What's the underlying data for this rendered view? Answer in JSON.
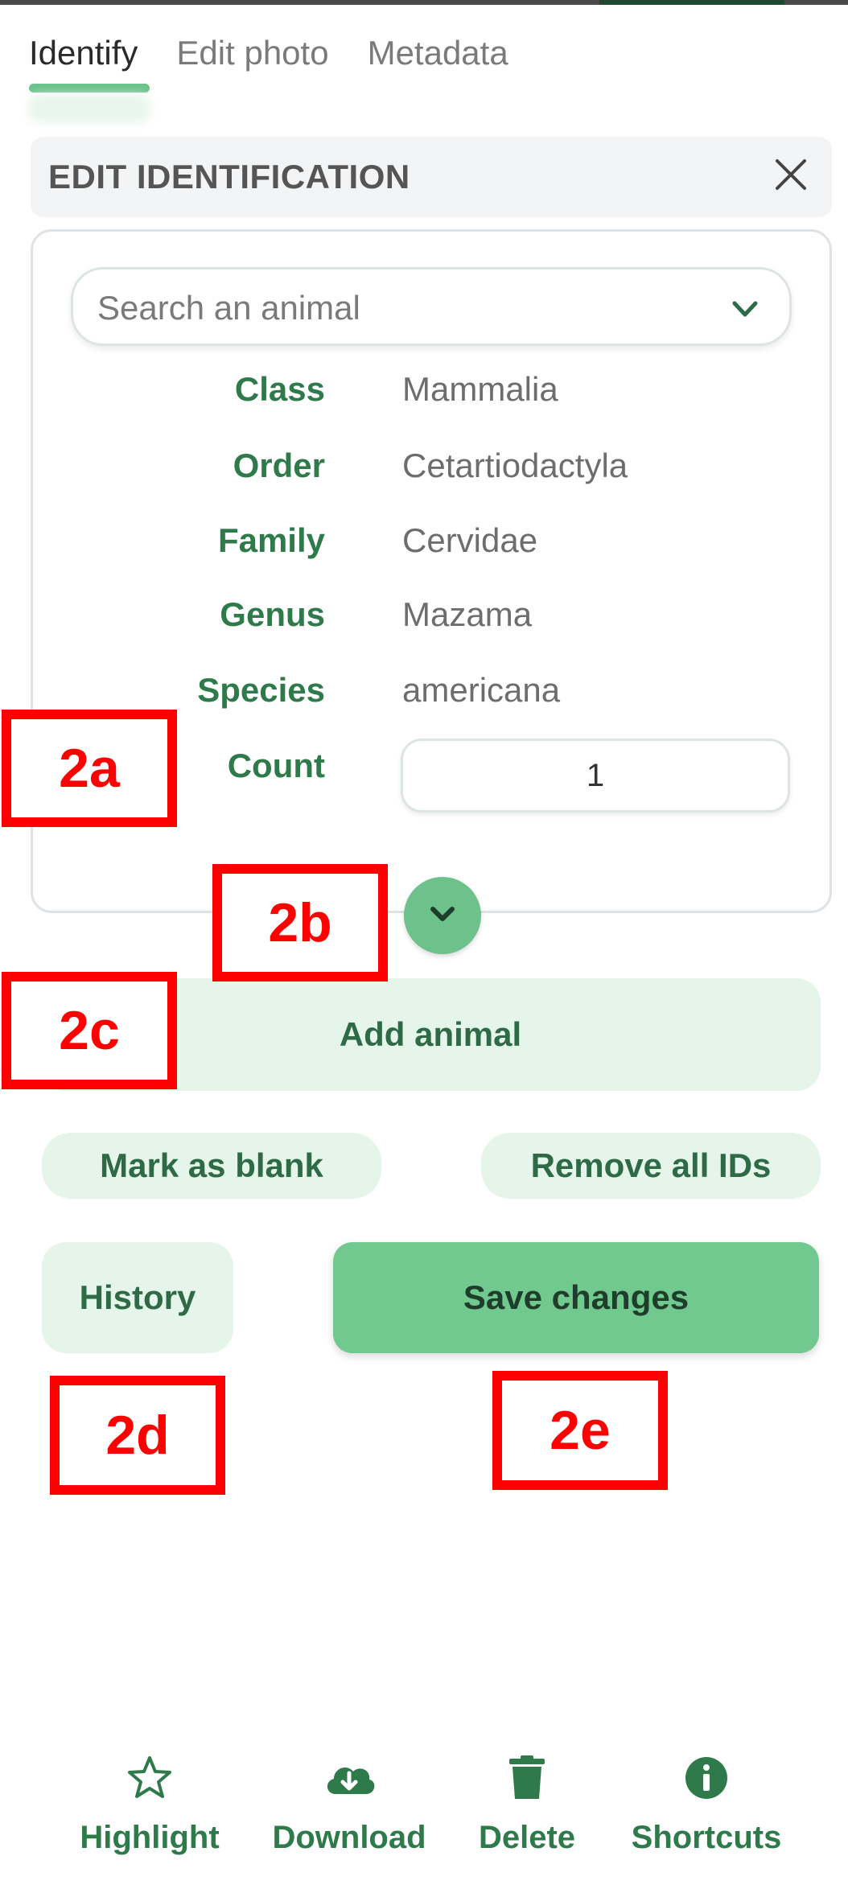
{
  "tabs": [
    {
      "label": "Identify",
      "active": true
    },
    {
      "label": "Edit photo",
      "active": false
    },
    {
      "label": "Metadata",
      "active": false
    }
  ],
  "panel": {
    "title": "EDIT IDENTIFICATION",
    "close_icon": "close-icon"
  },
  "search": {
    "placeholder": "Search an animal",
    "icon": "chevron-down-icon"
  },
  "taxonomy": [
    {
      "label": "Class",
      "value": "Mammalia"
    },
    {
      "label": "Order",
      "value": "Cetartiodactyla"
    },
    {
      "label": "Family",
      "value": "Cervidae"
    },
    {
      "label": "Genus",
      "value": "Mazama"
    },
    {
      "label": "Species",
      "value": "americana"
    }
  ],
  "count": {
    "label": "Count",
    "value": "1"
  },
  "buttons": {
    "add_animal": "Add animal",
    "mark_blank": "Mark as blank",
    "remove_all": "Remove all IDs",
    "history": "History",
    "save": "Save changes"
  },
  "annotations": [
    "2a",
    "2b",
    "2c",
    "2d",
    "2e"
  ],
  "toolbar": [
    {
      "label": "Highlight",
      "icon": "star-icon"
    },
    {
      "label": "Download",
      "icon": "cloud-download-icon"
    },
    {
      "label": "Delete",
      "icon": "trash-icon"
    },
    {
      "label": "Shortcuts",
      "icon": "info-icon"
    }
  ],
  "colors": {
    "accent_green": "#6cc28a",
    "label_green": "#2f7a4a",
    "light_green": "#e5f5ea",
    "annotation_red": "#ff0000"
  }
}
